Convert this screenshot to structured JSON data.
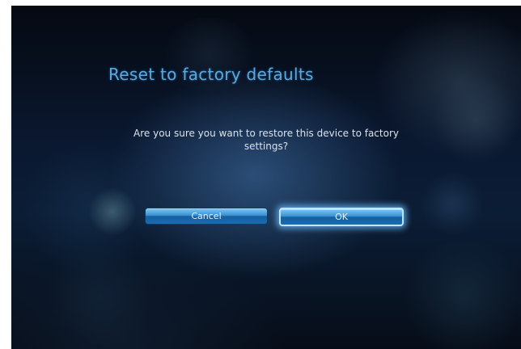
{
  "dialog": {
    "title": "Reset to factory defaults",
    "message": "Are you sure you want to restore this device to factory settings?"
  },
  "buttons": {
    "cancel_label": "Cancel",
    "ok_label": "OK",
    "focused": "OK"
  },
  "colors": {
    "title": "#5aa9de",
    "button_blue": "#3c92d2",
    "focus_glow": "#bfe6ff"
  }
}
